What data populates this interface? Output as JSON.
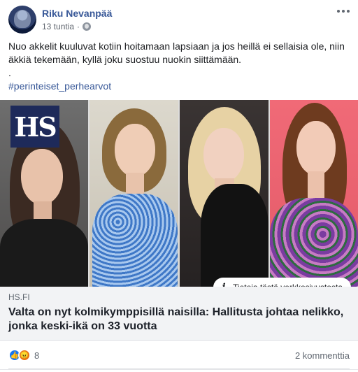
{
  "post": {
    "author": "Riku Nevanpää",
    "timestamp": "13 tuntia",
    "privacy_icon": "globe-icon",
    "text_line_1": "Nuo akkelit kuuluvat kotiin hoitamaan lapsiaan ja jos heillä ei sellaisia ole, niin äkkiä tekemään, kyllä joku suostuu nuokin siittämään.",
    "text_dot": ".",
    "hashtag": "#perinteiset_perhearvot"
  },
  "link": {
    "logo_text": "HS",
    "info_label": "Tietoja tästä verkkosivustosta",
    "domain": "HS.FI",
    "headline": "Valta on nyt kolmikymppisillä naisilla: Hallitusta johtaa nelikko, jonka keski-ikä on 33 vuotta"
  },
  "footer": {
    "reaction_count": "8",
    "comments": "2 kommenttia"
  },
  "colors": {
    "link_blue": "#385898",
    "caption_bg": "#f2f3f5",
    "like_blue": "#1877f2",
    "angry_orange": "#e9710f",
    "hs_navy": "#1e2a5a"
  }
}
